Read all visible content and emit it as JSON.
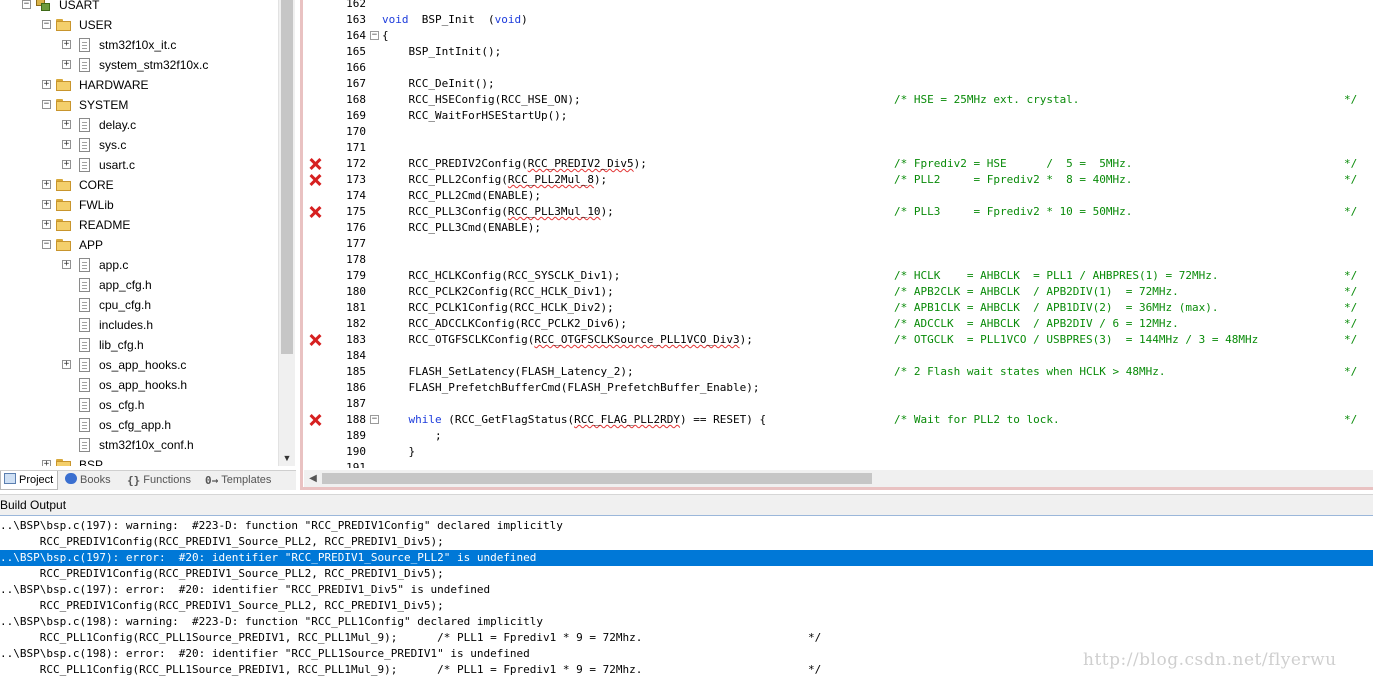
{
  "tree": [
    {
      "label": "USART",
      "kind": "group",
      "indent": 0,
      "expander": "-"
    },
    {
      "label": "USER",
      "kind": "folder",
      "indent": 1,
      "expander": "-"
    },
    {
      "label": "stm32f10x_it.c",
      "kind": "file",
      "indent": 2,
      "expander": "+"
    },
    {
      "label": "system_stm32f10x.c",
      "kind": "file",
      "indent": 2,
      "expander": "+"
    },
    {
      "label": "HARDWARE",
      "kind": "folder",
      "indent": 1,
      "expander": "+"
    },
    {
      "label": "SYSTEM",
      "kind": "folder",
      "indent": 1,
      "expander": "-"
    },
    {
      "label": "delay.c",
      "kind": "file",
      "indent": 2,
      "expander": "+"
    },
    {
      "label": "sys.c",
      "kind": "file",
      "indent": 2,
      "expander": "+"
    },
    {
      "label": "usart.c",
      "kind": "file",
      "indent": 2,
      "expander": "+"
    },
    {
      "label": "CORE",
      "kind": "folder",
      "indent": 1,
      "expander": "+"
    },
    {
      "label": "FWLib",
      "kind": "folder",
      "indent": 1,
      "expander": "+"
    },
    {
      "label": "README",
      "kind": "folder",
      "indent": 1,
      "expander": "+"
    },
    {
      "label": "APP",
      "kind": "folder",
      "indent": 1,
      "expander": "-"
    },
    {
      "label": "app.c",
      "kind": "file",
      "indent": 2,
      "expander": "+"
    },
    {
      "label": "app_cfg.h",
      "kind": "file",
      "indent": 2,
      "expander": ""
    },
    {
      "label": "cpu_cfg.h",
      "kind": "file",
      "indent": 2,
      "expander": ""
    },
    {
      "label": "includes.h",
      "kind": "file",
      "indent": 2,
      "expander": ""
    },
    {
      "label": "lib_cfg.h",
      "kind": "file",
      "indent": 2,
      "expander": ""
    },
    {
      "label": "os_app_hooks.c",
      "kind": "file",
      "indent": 2,
      "expander": "+"
    },
    {
      "label": "os_app_hooks.h",
      "kind": "file",
      "indent": 2,
      "expander": ""
    },
    {
      "label": "os_cfg.h",
      "kind": "file",
      "indent": 2,
      "expander": ""
    },
    {
      "label": "os_cfg_app.h",
      "kind": "file",
      "indent": 2,
      "expander": ""
    },
    {
      "label": "stm32f10x_conf.h",
      "kind": "file",
      "indent": 2,
      "expander": ""
    },
    {
      "label": "BSP",
      "kind": "folder",
      "indent": 1,
      "expander": "+"
    }
  ],
  "panel_tabs": [
    {
      "label": "Project",
      "icon": "project-icon",
      "active": true
    },
    {
      "label": "Books",
      "icon": "books-icon",
      "active": false
    },
    {
      "label": "Functions",
      "icon": "functions-icon",
      "glyph": "{}",
      "active": false
    },
    {
      "label": "Templates",
      "icon": "templates-icon",
      "glyph": "0→",
      "active": false
    }
  ],
  "code_lines": [
    {
      "num": "162",
      "err": false,
      "fold": "",
      "code": [],
      "comment": "",
      "comment_end": ""
    },
    {
      "num": "163",
      "err": false,
      "fold": "",
      "code": [
        {
          "t": "void",
          "k": "kw"
        },
        {
          "t": "  BSP_Init  ("
        },
        {
          "t": "void",
          "k": "kw"
        },
        {
          "t": ")"
        }
      ],
      "comment": "",
      "comment_end": ""
    },
    {
      "num": "164",
      "err": false,
      "fold": "-",
      "code": [
        {
          "t": "{"
        }
      ],
      "comment": "",
      "comment_end": ""
    },
    {
      "num": "165",
      "err": false,
      "fold": "",
      "code": [
        {
          "t": "    BSP_IntInit();"
        }
      ],
      "comment": "",
      "comment_end": ""
    },
    {
      "num": "166",
      "err": false,
      "fold": "",
      "code": [],
      "comment": "",
      "comment_end": ""
    },
    {
      "num": "167",
      "err": false,
      "fold": "",
      "code": [
        {
          "t": "    RCC_DeInit();"
        }
      ],
      "comment": "",
      "comment_end": ""
    },
    {
      "num": "168",
      "err": false,
      "fold": "",
      "code": [
        {
          "t": "    RCC_HSEConfig(RCC_HSE_ON);"
        }
      ],
      "comment": "/* HSE = 25MHz ext. crystal.",
      "comment_end": "*/"
    },
    {
      "num": "169",
      "err": false,
      "fold": "",
      "code": [
        {
          "t": "    RCC_WaitForHSEStartUp();"
        }
      ],
      "comment": "",
      "comment_end": ""
    },
    {
      "num": "170",
      "err": false,
      "fold": "",
      "code": [],
      "comment": "",
      "comment_end": ""
    },
    {
      "num": "171",
      "err": false,
      "fold": "",
      "code": [],
      "comment": "",
      "comment_end": ""
    },
    {
      "num": "172",
      "err": true,
      "fold": "",
      "code": [
        {
          "t": "    RCC_PREDIV2Config("
        },
        {
          "t": "RCC_PREDIV2_Div5",
          "k": "sq"
        },
        {
          "t": ");"
        }
      ],
      "comment": "/* Fprediv2 = HSE      /  5 =  5MHz.",
      "comment_end": "*/"
    },
    {
      "num": "173",
      "err": true,
      "fold": "",
      "code": [
        {
          "t": "    RCC_PLL2Config("
        },
        {
          "t": "RCC_PLL2Mul_8",
          "k": "sq"
        },
        {
          "t": ");"
        }
      ],
      "comment": "/* PLL2     = Fprediv2 *  8 = 40MHz.",
      "comment_end": "*/"
    },
    {
      "num": "174",
      "err": false,
      "fold": "",
      "code": [
        {
          "t": "    RCC_PLL2Cmd(ENABLE);"
        }
      ],
      "comment": "",
      "comment_end": ""
    },
    {
      "num": "175",
      "err": true,
      "fold": "",
      "code": [
        {
          "t": "    RCC_PLL3Config("
        },
        {
          "t": "RCC_PLL3Mul_10",
          "k": "sq"
        },
        {
          "t": ");"
        }
      ],
      "comment": "/* PLL3     = Fprediv2 * 10 = 50MHz.",
      "comment_end": "*/"
    },
    {
      "num": "176",
      "err": false,
      "fold": "",
      "code": [
        {
          "t": "    RCC_PLL3Cmd(ENABLE);"
        }
      ],
      "comment": "",
      "comment_end": ""
    },
    {
      "num": "177",
      "err": false,
      "fold": "",
      "code": [],
      "comment": "",
      "comment_end": ""
    },
    {
      "num": "178",
      "err": false,
      "fold": "",
      "code": [],
      "comment": "",
      "comment_end": ""
    },
    {
      "num": "179",
      "err": false,
      "fold": "",
      "code": [
        {
          "t": "    RCC_HCLKConfig(RCC_SYSCLK_Div1);"
        }
      ],
      "comment": "/* HCLK    = AHBCLK  = PLL1 / AHBPRES(1) = 72MHz.",
      "comment_end": "*/"
    },
    {
      "num": "180",
      "err": false,
      "fold": "",
      "code": [
        {
          "t": "    RCC_PCLK2Config(RCC_HCLK_Div1);"
        }
      ],
      "comment": "/* APB2CLK = AHBCLK  / APB2DIV(1)  = 72MHz.",
      "comment_end": "*/"
    },
    {
      "num": "181",
      "err": false,
      "fold": "",
      "code": [
        {
          "t": "    RCC_PCLK1Config(RCC_HCLK_Div2);"
        }
      ],
      "comment": "/* APB1CLK = AHBCLK  / APB1DIV(2)  = 36MHz (max).",
      "comment_end": "*/"
    },
    {
      "num": "182",
      "err": false,
      "fold": "",
      "code": [
        {
          "t": "    RCC_ADCCLKConfig(RCC_PCLK2_Div6);"
        }
      ],
      "comment": "/* ADCCLK  = AHBCLK  / APB2DIV / 6 = 12MHz.",
      "comment_end": "*/"
    },
    {
      "num": "183",
      "err": true,
      "fold": "",
      "code": [
        {
          "t": "    RCC_OTGFSCLKConfig("
        },
        {
          "t": "RCC_OTGFSCLKSource_PLL1VCO_Div3",
          "k": "sq"
        },
        {
          "t": ");"
        }
      ],
      "comment": "/* OTGCLK  = PLL1VCO / USBPRES(3)  = 144MHz / 3 = 48MHz",
      "comment_end": "*/"
    },
    {
      "num": "184",
      "err": false,
      "fold": "",
      "code": [],
      "comment": "",
      "comment_end": ""
    },
    {
      "num": "185",
      "err": false,
      "fold": "",
      "code": [
        {
          "t": "    FLASH_SetLatency(FLASH_Latency_2);"
        }
      ],
      "comment": "/* 2 Flash wait states when HCLK > 48MHz.",
      "comment_end": "*/"
    },
    {
      "num": "186",
      "err": false,
      "fold": "",
      "code": [
        {
          "t": "    FLASH_PrefetchBufferCmd(FLASH_PrefetchBuffer_Enable);"
        }
      ],
      "comment": "",
      "comment_end": ""
    },
    {
      "num": "187",
      "err": false,
      "fold": "",
      "code": [],
      "comment": "",
      "comment_end": ""
    },
    {
      "num": "188",
      "err": true,
      "fold": "-",
      "code": [
        {
          "t": "    "
        },
        {
          "t": "while",
          "k": "kw"
        },
        {
          "t": " (RCC_GetFlagStatus("
        },
        {
          "t": "RCC_FLAG_PLL2RDY",
          "k": "sq"
        },
        {
          "t": ") == RESET) {"
        }
      ],
      "comment": "/* Wait for PLL2 to lock.",
      "comment_end": "*/"
    },
    {
      "num": "189",
      "err": false,
      "fold": "",
      "code": [
        {
          "t": "        ;"
        }
      ],
      "comment": "",
      "comment_end": ""
    },
    {
      "num": "190",
      "err": false,
      "fold": "",
      "code": [
        {
          "t": "    }"
        }
      ],
      "comment": "",
      "comment_end": ""
    },
    {
      "num": "191",
      "err": false,
      "fold": "",
      "code": [],
      "comment": "",
      "comment_end": ""
    }
  ],
  "build_output": {
    "title": "Build Output",
    "selected_index": 2,
    "lines": [
      "..\\BSP\\bsp.c(197): warning:  #223-D: function \"RCC_PREDIV1Config\" declared implicitly",
      "      RCC_PREDIV1Config(RCC_PREDIV1_Source_PLL2, RCC_PREDIV1_Div5);",
      "..\\BSP\\bsp.c(197): error:  #20: identifier \"RCC_PREDIV1_Source_PLL2\" is undefined",
      "      RCC_PREDIV1Config(RCC_PREDIV1_Source_PLL2, RCC_PREDIV1_Div5);",
      "..\\BSP\\bsp.c(197): error:  #20: identifier \"RCC_PREDIV1_Div5\" is undefined",
      "      RCC_PREDIV1Config(RCC_PREDIV1_Source_PLL2, RCC_PREDIV1_Div5);",
      "..\\BSP\\bsp.c(198): warning:  #223-D: function \"RCC_PLL1Config\" declared implicitly",
      "      RCC_PLL1Config(RCC_PLL1Source_PREDIV1, RCC_PLL1Mul_9);      /* PLL1 = Fprediv1 * 9 = 72Mhz.                         */",
      "..\\BSP\\bsp.c(198): error:  #20: identifier \"RCC_PLL1Source_PREDIV1\" is undefined",
      "      RCC_PLL1Config(RCC_PLL1Source_PREDIV1, RCC_PLL1Mul_9);      /* PLL1 = Fprediv1 * 9 = 72Mhz.                         */"
    ]
  },
  "watermark": "http://blog.csdn.net/flyerwu",
  "colors": {
    "keyword": "#1d3cdc",
    "comment": "#098b09",
    "error_marker": "#d62020",
    "selection": "#0078d7"
  }
}
